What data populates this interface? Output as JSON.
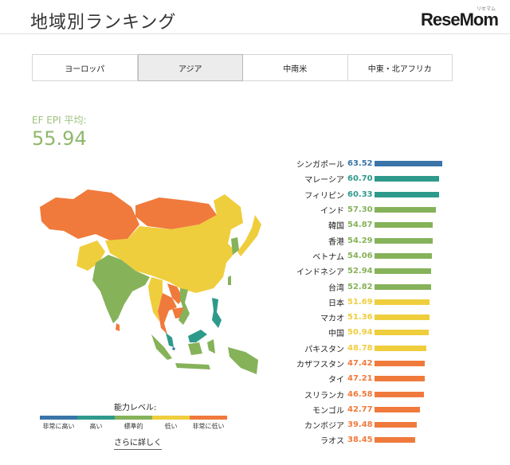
{
  "header": {
    "title": "地域別ランキング",
    "logo": "ReseMom",
    "logo_sub": "リセマム"
  },
  "tabs": [
    {
      "label": "ヨーロッパ",
      "active": false
    },
    {
      "label": "アジア",
      "active": true
    },
    {
      "label": "中南米",
      "active": false
    },
    {
      "label": "中東・北アフリカ",
      "active": false
    }
  ],
  "average": {
    "label": "EF EPI 平均:",
    "value": "55.94"
  },
  "levels": [
    {
      "label": "非常に高い",
      "color": "#3a74a8"
    },
    {
      "label": "高い",
      "color": "#2d9a8c"
    },
    {
      "label": "標準的",
      "color": "#86b25a"
    },
    {
      "label": "低い",
      "color": "#efce3d"
    },
    {
      "label": "非常に低い",
      "color": "#f07a3c"
    }
  ],
  "legend_title": "能力レベル:",
  "more_link": "さらに詳しく",
  "ranking": [
    {
      "name": "シンガポール",
      "score": "63.52",
      "level": 0
    },
    {
      "name": "マレーシア",
      "score": "60.70",
      "level": 1
    },
    {
      "name": "フィリピン",
      "score": "60.33",
      "level": 1
    },
    {
      "name": "インド",
      "score": "57.30",
      "level": 2
    },
    {
      "name": "韓国",
      "score": "54.87",
      "level": 2
    },
    {
      "name": "香港",
      "score": "54.29",
      "level": 2
    },
    {
      "name": "ベトナム",
      "score": "54.06",
      "level": 2
    },
    {
      "name": "インドネシア",
      "score": "52.94",
      "level": 2
    },
    {
      "name": "台湾",
      "score": "52.82",
      "level": 2
    },
    {
      "name": "日本",
      "score": "51.69",
      "level": 3
    },
    {
      "name": "マカオ",
      "score": "51.36",
      "level": 3
    },
    {
      "name": "中国",
      "score": "50.94",
      "level": 3
    },
    {
      "name": "パキスタン",
      "score": "48.78",
      "level": 3
    },
    {
      "name": "カザフスタン",
      "score": "47.42",
      "level": 4
    },
    {
      "name": "タイ",
      "score": "47.21",
      "level": 4
    },
    {
      "name": "スリランカ",
      "score": "46.58",
      "level": 4
    },
    {
      "name": "モンゴル",
      "score": "42.77",
      "level": 4
    },
    {
      "name": "カンボジア",
      "score": "39.48",
      "level": 4
    },
    {
      "name": "ラオス",
      "score": "38.45",
      "level": 4
    }
  ]
}
